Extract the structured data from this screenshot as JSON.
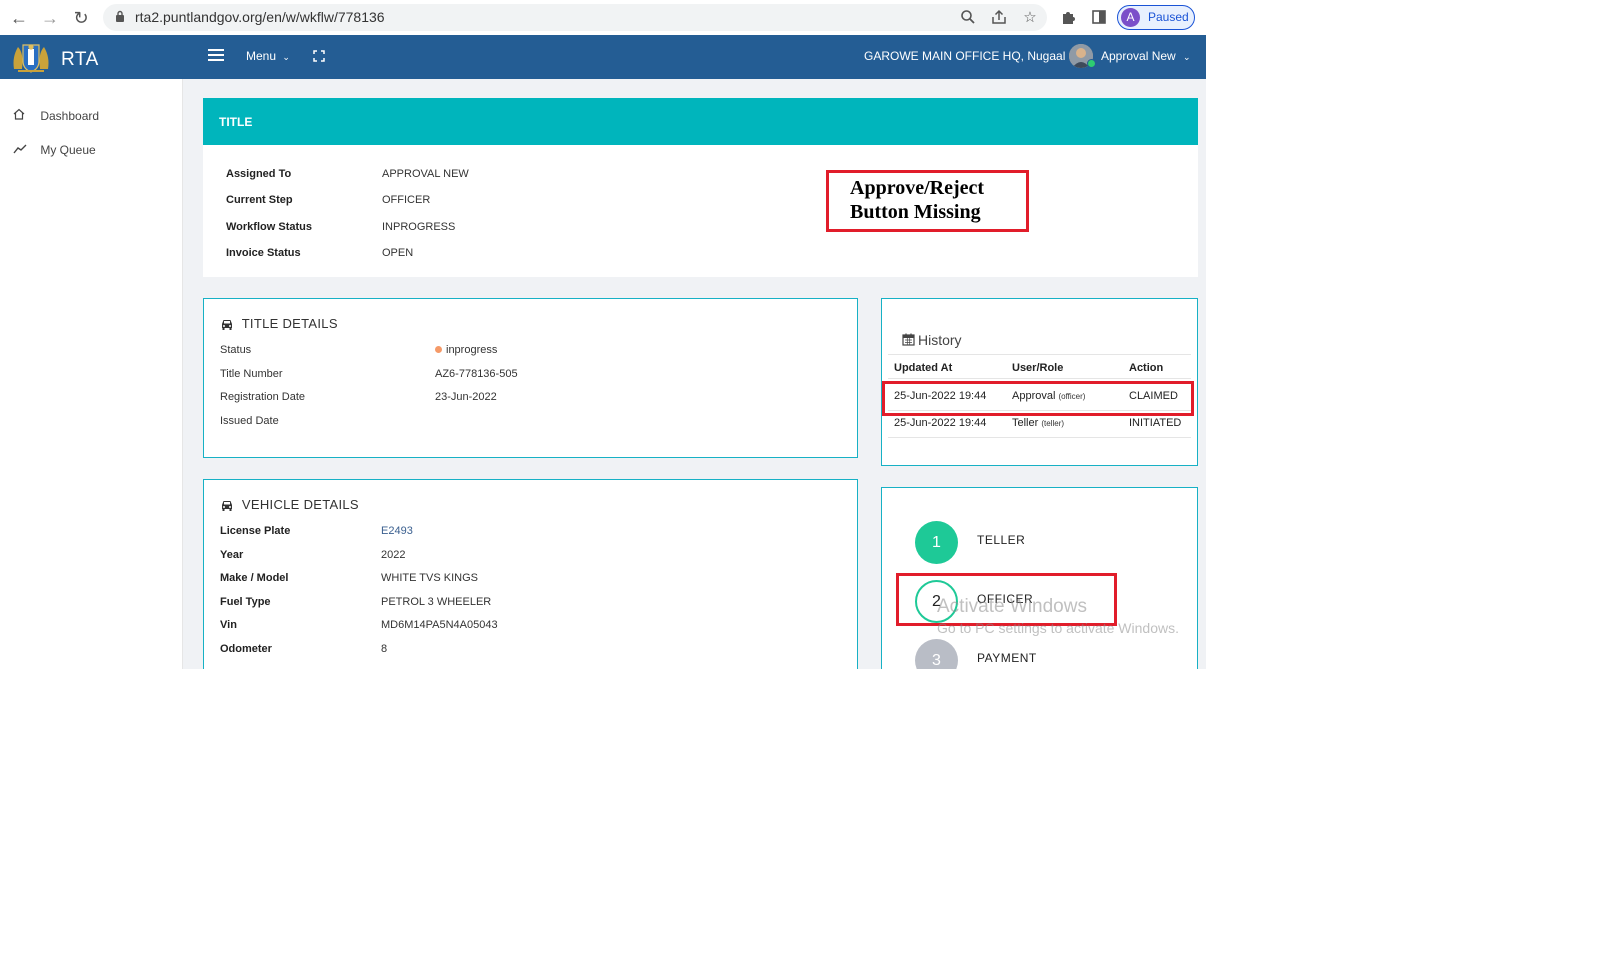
{
  "browser": {
    "url": "rta2.puntlandgov.org/en/w/wkflw/778136",
    "profile_initial": "A",
    "profile_status": "Paused"
  },
  "header": {
    "brand": "RTA",
    "menu_label": "Menu",
    "office": "GAROWE MAIN OFFICE HQ, Nugaal",
    "user": "Approval New",
    "bg_color": "#245d94"
  },
  "sidebar": {
    "items": [
      {
        "label": "Dashboard",
        "icon": "home-icon"
      },
      {
        "label": "My Queue",
        "icon": "trend-icon"
      }
    ]
  },
  "title_card": {
    "heading": "TITLE",
    "accent_color": "#00b5bc",
    "fields": [
      {
        "label": "Assigned To",
        "value": "APPROVAL NEW"
      },
      {
        "label": "Current Step",
        "value": "OFFICER"
      },
      {
        "label": "Workflow Status",
        "value": "INPROGRESS"
      },
      {
        "label": "Invoice Status",
        "value": "OPEN"
      }
    ]
  },
  "annotation": {
    "line1": "Approve/Reject",
    "line2": "Button Missing",
    "color": "#e11d2a"
  },
  "title_details": {
    "heading": "TITLE DETAILS",
    "fields": [
      {
        "label": "Status",
        "value": "inprogress"
      },
      {
        "label": "Title Number",
        "value": "AZ6-778136-505"
      },
      {
        "label": "Registration Date",
        "value": "23-Jun-2022"
      },
      {
        "label": "Issued Date",
        "value": ""
      }
    ]
  },
  "vehicle_details": {
    "heading": "VEHICLE DETAILS",
    "fields": [
      {
        "label": "License Plate",
        "value": "E2493"
      },
      {
        "label": "Year",
        "value": "2022"
      },
      {
        "label": "Make / Model",
        "value": "WHITE TVS KINGS"
      },
      {
        "label": "Fuel Type",
        "value": "PETROL 3 WHEELER"
      },
      {
        "label": "Vin",
        "value": "MD6M14PA5N4A05043"
      },
      {
        "label": "Odometer",
        "value": "8"
      }
    ]
  },
  "history": {
    "heading": "History",
    "columns": [
      "Updated At",
      "User/Role",
      "Action"
    ],
    "rows": [
      {
        "updated_at": "25-Jun-2022 19:44",
        "user": "Approval",
        "role": "(officer)",
        "action": "CLAIMED"
      },
      {
        "updated_at": "25-Jun-2022 19:44",
        "user": "Teller",
        "role": "(teller)",
        "action": "INITIATED"
      }
    ]
  },
  "steps": [
    {
      "number": "1",
      "label": "TELLER",
      "state": "done",
      "color": "#1ec997"
    },
    {
      "number": "2",
      "label": "OFFICER",
      "state": "current",
      "color": "#1ec997"
    },
    {
      "number": "3",
      "label": "PAYMENT",
      "state": "pending",
      "color": "#b9bdc6"
    }
  ],
  "watermark": {
    "line1": "Activate Windows",
    "line2": "Go to PC settings to activate Windows."
  }
}
